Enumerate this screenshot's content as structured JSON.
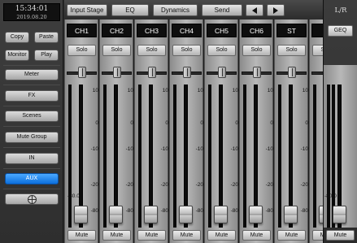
{
  "clock": {
    "time": "15:34:01",
    "date": "2019.08.20"
  },
  "left_panel": {
    "copy_label": "Copy",
    "paste_label": "Paste",
    "monitor_label": "Monitor",
    "play_label": "Play",
    "meter_label": "Meter",
    "fx_label": "FX",
    "scenes_label": "Scenes",
    "mute_group_label": "Mute Group",
    "in_label": "IN",
    "aux_label": "AUX",
    "target_icon": "crosshair-icon"
  },
  "topbar": {
    "input_stage_label": "Input Stage",
    "eq_label": "EQ",
    "dynamics_label": "Dynamics",
    "send_label": "Send",
    "prev_icon": "arrow-left-icon",
    "next_icon": "arrow-right-icon"
  },
  "strip_labels": {
    "solo": "Solo",
    "mute": "Mute"
  },
  "scale": [
    "10",
    "0",
    "-10",
    "-20",
    "-80"
  ],
  "channels": [
    {
      "name": "CH1",
      "fader_db": "-80.0",
      "fader_fraction": 0.03
    },
    {
      "name": "CH2",
      "fader_fraction": 0.03
    },
    {
      "name": "CH3",
      "fader_fraction": 0.03
    },
    {
      "name": "CH4",
      "fader_fraction": 0.03
    },
    {
      "name": "CH5",
      "fader_fraction": 0.03
    },
    {
      "name": "CH6",
      "fader_fraction": 0.03
    },
    {
      "name": "ST",
      "fader_fraction": 0.03
    },
    {
      "name": "P",
      "fader_fraction": 0.03
    }
  ],
  "master": {
    "name": "L/R",
    "geq_label": "GEQ",
    "fader_db": "-80.0",
    "fader_fraction": 0.03,
    "mute_label": "Mute"
  },
  "colors": {
    "active_button": "#1a7fe8",
    "panel": "#2e2e2e"
  }
}
